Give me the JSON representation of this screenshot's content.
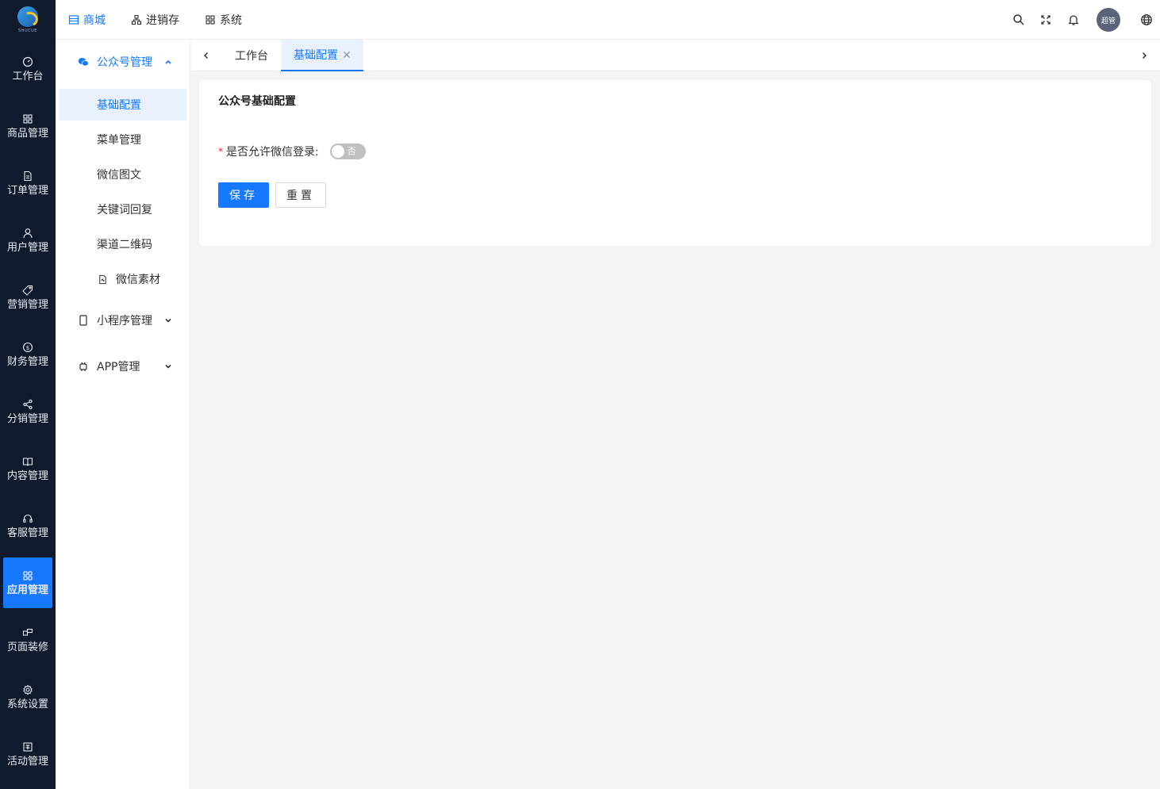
{
  "logo": {
    "text": "SHUCUE"
  },
  "sidebar": {
    "items": [
      {
        "label": "工作台",
        "icon": "dashboard-icon"
      },
      {
        "label": "商品管理",
        "icon": "grid-icon"
      },
      {
        "label": "订单管理",
        "icon": "document-icon"
      },
      {
        "label": "用户管理",
        "icon": "user-icon"
      },
      {
        "label": "营销管理",
        "icon": "tag-icon"
      },
      {
        "label": "财务管理",
        "icon": "dollar-icon"
      },
      {
        "label": "分销管理",
        "icon": "share-icon"
      },
      {
        "label": "内容管理",
        "icon": "book-icon"
      },
      {
        "label": "客服管理",
        "icon": "headset-icon"
      },
      {
        "label": "应用管理",
        "icon": "apps-icon",
        "active": true
      },
      {
        "label": "页面装修",
        "icon": "layout-icon"
      },
      {
        "label": "系统设置",
        "icon": "gear-icon"
      },
      {
        "label": "活动管理",
        "icon": "activity-icon"
      }
    ]
  },
  "header": {
    "tabs": [
      {
        "label": "商城",
        "icon": "store-icon",
        "active": true
      },
      {
        "label": "进销存",
        "icon": "hierarchy-icon"
      },
      {
        "label": "系统",
        "icon": "apps-icon"
      }
    ],
    "avatar_text": "超管"
  },
  "submenu": {
    "groups": [
      {
        "label": "公众号管理",
        "icon": "wechat-icon",
        "open": true
      },
      {
        "label": "小程序管理",
        "icon": "mobile-icon"
      },
      {
        "label": "APP管理",
        "icon": "android-icon"
      }
    ],
    "items": [
      {
        "label": "基础配置",
        "active": true
      },
      {
        "label": "菜单管理"
      },
      {
        "label": "微信图文"
      },
      {
        "label": "关键词回复"
      },
      {
        "label": "渠道二维码"
      },
      {
        "label": "微信素材",
        "icon": "file-icon"
      }
    ]
  },
  "tabbar": {
    "tabs": [
      {
        "label": "工作台"
      },
      {
        "label": "基础配置",
        "active": true,
        "closable": true
      }
    ]
  },
  "card": {
    "title": "公众号基础配置",
    "field_label": "是否允许微信登录:",
    "required_mark": "*",
    "switch_text": "否",
    "switch_on": false,
    "save_label": "保存",
    "reset_label": "重置"
  },
  "colors": {
    "accent": "#1677ff",
    "sidebar_bg": "#0f1a2d",
    "page_bg": "#f4f4f4"
  }
}
